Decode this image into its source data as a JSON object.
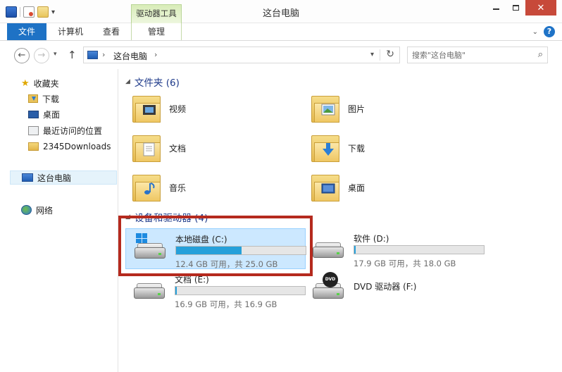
{
  "window": {
    "title": "这台电脑",
    "context_tab_group": "驱动器工具"
  },
  "ribbon": {
    "tabs": [
      {
        "label": "文件"
      },
      {
        "label": "计算机"
      },
      {
        "label": "查看"
      },
      {
        "label": "管理"
      }
    ]
  },
  "address": {
    "crumb": "这台电脑",
    "search_placeholder": "搜索\"这台电脑\""
  },
  "nav": {
    "favorites": "收藏夹",
    "items": [
      {
        "label": "下载",
        "icon": "download-folder-icon"
      },
      {
        "label": "桌面",
        "icon": "desktop-icon"
      },
      {
        "label": "最近访问的位置",
        "icon": "recent-places-icon"
      },
      {
        "label": "2345Downloads",
        "icon": "folder-icon"
      }
    ],
    "this_pc": "这台电脑",
    "network": "网络"
  },
  "folders": {
    "header": "文件夹 (6)",
    "items": [
      {
        "label": "视频",
        "icon": "videos-folder-icon"
      },
      {
        "label": "图片",
        "icon": "pictures-folder-icon"
      },
      {
        "label": "文档",
        "icon": "documents-folder-icon"
      },
      {
        "label": "下载",
        "icon": "downloads-folder-icon"
      },
      {
        "label": "音乐",
        "icon": "music-folder-icon"
      },
      {
        "label": "桌面",
        "icon": "desktop-folder-icon"
      }
    ]
  },
  "drives": {
    "header": "设备和驱动器 (4)",
    "items": [
      {
        "name": "本地磁盘 (C:)",
        "info": "12.4 GB 可用，共 25.0 GB",
        "used_fraction": 0.504,
        "selected": true
      },
      {
        "name": "软件 (D:)",
        "info": "17.9 GB 可用，共 18.0 GB",
        "used_fraction": 0.006,
        "selected": false
      },
      {
        "name": "文档 (E:)",
        "info": "16.9 GB 可用，共 16.9 GB",
        "used_fraction": 0.004,
        "selected": false
      },
      {
        "name": "DVD 驱动器 (F:)",
        "info": "",
        "selected": false
      }
    ]
  },
  "colors": {
    "accent": "#1e72c5",
    "highlight_box": "#b52a1e",
    "drive_fill": "#26a0da"
  }
}
